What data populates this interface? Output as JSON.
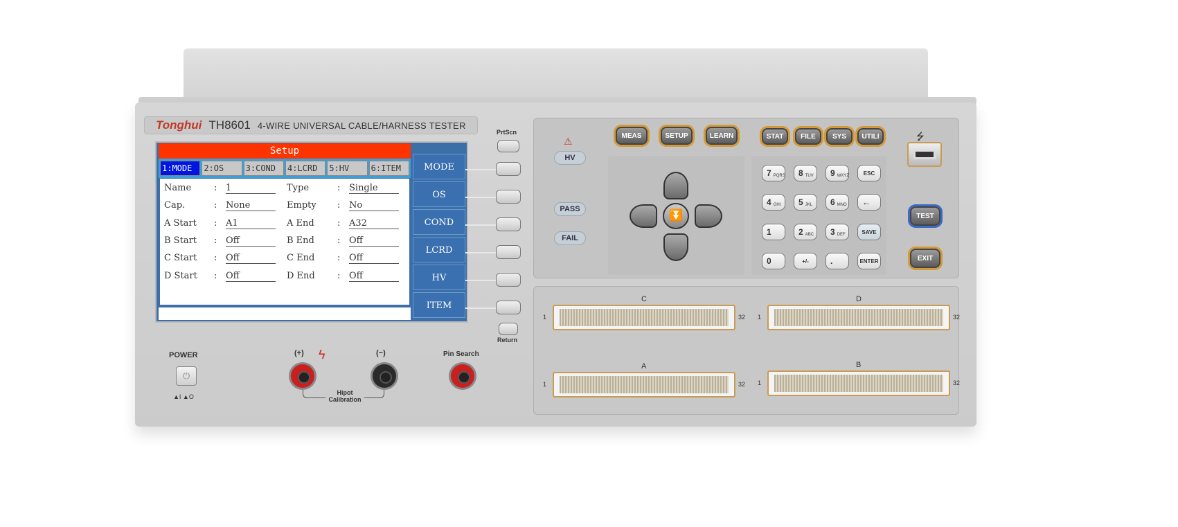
{
  "device": {
    "brand": "Tonghui",
    "model": "TH8601",
    "description": "4-WIRE UNIVERSAL CABLE/HARNESS TESTER"
  },
  "screen": {
    "title": "Setup",
    "tabs": [
      {
        "label": "1:MODE",
        "active": true
      },
      {
        "label": "2:OS"
      },
      {
        "label": "3:COND"
      },
      {
        "label": "4:LCRD"
      },
      {
        "label": "5:HV"
      },
      {
        "label": "6:ITEM"
      }
    ],
    "fields_left": [
      {
        "label": "Name",
        "value": "1"
      },
      {
        "label": "Cap.",
        "value": "None"
      },
      {
        "label": "A Start",
        "value": "A1"
      },
      {
        "label": "B Start",
        "value": "Off"
      },
      {
        "label": "C Start",
        "value": "Off"
      },
      {
        "label": "D Start",
        "value": "Off"
      }
    ],
    "fields_right": [
      {
        "label": "Type",
        "value": "Single"
      },
      {
        "label": "Empty",
        "value": "No"
      },
      {
        "label": "A End",
        "value": "A32"
      },
      {
        "label": "B End",
        "value": "Off"
      },
      {
        "label": "C End",
        "value": "Off"
      },
      {
        "label": "D End",
        "value": "Off"
      }
    ],
    "softkeys": [
      "MODE",
      "OS",
      "COND",
      "LCRD",
      "HV",
      "ITEM"
    ]
  },
  "side_buttons": {
    "top": "PrtScn",
    "bottom": "Return"
  },
  "power": {
    "label": "POWER",
    "legend": "▲I ▲O"
  },
  "terminals": {
    "plus": "(+)",
    "minus": "(−)",
    "pin_search": "Pin Search",
    "calibration": "Hipot Calibration"
  },
  "indicators": {
    "hv": "HV",
    "pass": "PASS",
    "fail": "FAIL"
  },
  "function_keys": [
    "MEAS",
    "SETUP",
    "LEARN",
    "STAT",
    "FILE",
    "SYS",
    "UTILI"
  ],
  "keypad": [
    [
      "7",
      "PQRS"
    ],
    [
      "8",
      "TUV"
    ],
    [
      "9",
      "WXYZ"
    ],
    [
      "ESC",
      ""
    ],
    [
      "4",
      "GHI"
    ],
    [
      "5",
      "JKL"
    ],
    [
      "6",
      "MNO"
    ],
    [
      "←",
      ""
    ],
    [
      "1",
      ""
    ],
    [
      "2",
      "ABC"
    ],
    [
      "3",
      "DEF"
    ],
    [
      "SAVE",
      ""
    ],
    [
      "0",
      ""
    ],
    [
      "+/-",
      ""
    ],
    [
      ".",
      ""
    ],
    [
      "ENTER",
      ""
    ]
  ],
  "right_keys": {
    "test": "TEST",
    "exit": "EXIT",
    "usb": "usb-icon"
  },
  "connectors": [
    {
      "name": "C",
      "start": "1",
      "end": "32"
    },
    {
      "name": "D",
      "start": "1",
      "end": "32"
    },
    {
      "name": "A",
      "start": "1",
      "end": "32"
    },
    {
      "name": "B",
      "start": "1",
      "end": "32"
    }
  ],
  "colors": {
    "screen_header": "#ff3300",
    "softkey": "#3a6fb0",
    "key_ring": "#d49a3a",
    "terminal_red": "#c8201e"
  }
}
